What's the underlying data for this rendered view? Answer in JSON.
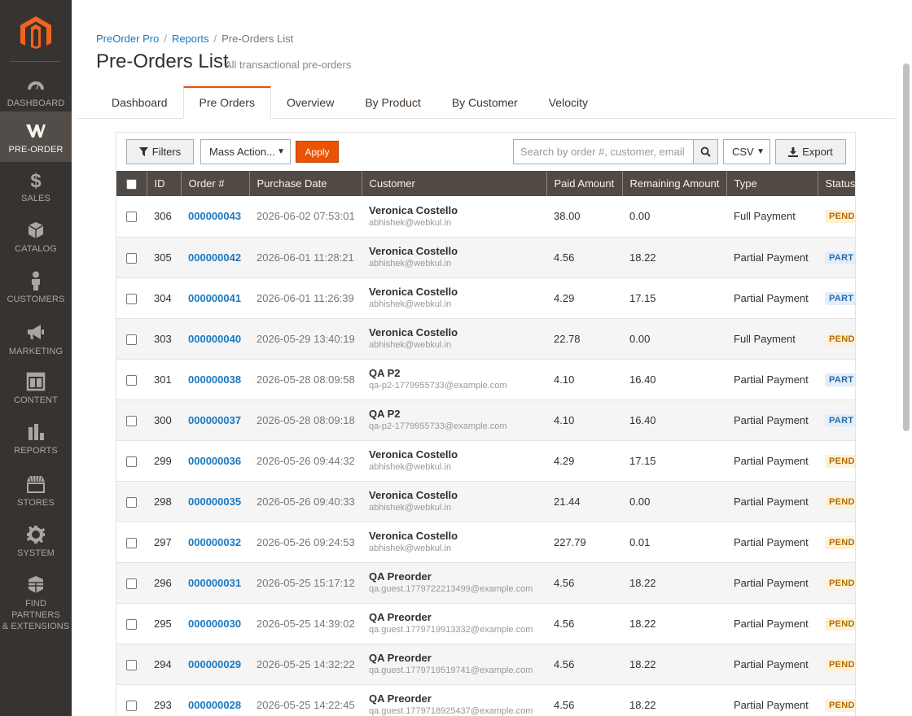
{
  "sidebar": {
    "items": [
      {
        "label": "Dashboard",
        "icon": "dashboard-icon",
        "active": false
      },
      {
        "label": "Pre-Order",
        "icon": "preorder-icon",
        "active": true
      },
      {
        "label": "Sales",
        "icon": "dollar-icon",
        "active": false
      },
      {
        "label": "Catalog",
        "icon": "box-icon",
        "active": false
      },
      {
        "label": "Customers",
        "icon": "person-icon",
        "active": false
      },
      {
        "label": "Marketing",
        "icon": "megaphone-icon",
        "active": false
      },
      {
        "label": "Content",
        "icon": "layout-icon",
        "active": false
      },
      {
        "label": "Reports",
        "icon": "bar-chart-icon",
        "active": false
      },
      {
        "label": "Stores",
        "icon": "store-icon",
        "active": false
      },
      {
        "label": "System",
        "icon": "gear-icon",
        "active": false
      },
      {
        "label1": "Find Partners",
        "label2": "& Extensions",
        "icon": "extensions-icon",
        "active": false
      }
    ]
  },
  "breadcrumb": {
    "item1": "PreOrder Pro",
    "item2": "Reports",
    "current": "Pre-Orders List"
  },
  "header": {
    "title": "Pre-Orders List",
    "subtitle": "All transactional pre-orders"
  },
  "tabs": [
    {
      "label": "Dashboard",
      "active": false
    },
    {
      "label": "Pre Orders",
      "active": true
    },
    {
      "label": "Overview",
      "active": false
    },
    {
      "label": "By Product",
      "active": false
    },
    {
      "label": "By Customer",
      "active": false
    },
    {
      "label": "Velocity",
      "active": false
    }
  ],
  "toolbar": {
    "filters_label": "Filters",
    "mass_action_label": "Mass Action...",
    "apply_label": "Apply",
    "search_placeholder": "Search by order #, customer, email",
    "export_format": "CSV",
    "export_label": "Export"
  },
  "table": {
    "columns": [
      "ID",
      "Order #",
      "Purchase Date",
      "Customer",
      "Paid Amount",
      "Remaining Amount",
      "Type",
      "Status"
    ],
    "rows": [
      {
        "id": "306",
        "order": "000000043",
        "date": "2026-06-02 07:53:01",
        "name": "Veronica Costello",
        "email": "abhishek@webkul.in",
        "paid": "38.00",
        "remaining": "0.00",
        "type": "Full Payment",
        "status": "PEND"
      },
      {
        "id": "305",
        "order": "000000042",
        "date": "2026-06-01 11:28:21",
        "name": "Veronica Costello",
        "email": "abhishek@webkul.in",
        "paid": "4.56",
        "remaining": "18.22",
        "type": "Partial Payment",
        "status": "PART"
      },
      {
        "id": "304",
        "order": "000000041",
        "date": "2026-06-01 11:26:39",
        "name": "Veronica Costello",
        "email": "abhishek@webkul.in",
        "paid": "4.29",
        "remaining": "17.15",
        "type": "Partial Payment",
        "status": "PART"
      },
      {
        "id": "303",
        "order": "000000040",
        "date": "2026-05-29 13:40:19",
        "name": "Veronica Costello",
        "email": "abhishek@webkul.in",
        "paid": "22.78",
        "remaining": "0.00",
        "type": "Full Payment",
        "status": "PEND"
      },
      {
        "id": "301",
        "order": "000000038",
        "date": "2026-05-28 08:09:58",
        "name": "QA P2",
        "email": "qa-p2-1779955733@example.com",
        "paid": "4.10",
        "remaining": "16.40",
        "type": "Partial Payment",
        "status": "PART"
      },
      {
        "id": "300",
        "order": "000000037",
        "date": "2026-05-28 08:09:18",
        "name": "QA P2",
        "email": "qa-p2-1779955733@example.com",
        "paid": "4.10",
        "remaining": "16.40",
        "type": "Partial Payment",
        "status": "PART"
      },
      {
        "id": "299",
        "order": "000000036",
        "date": "2026-05-26 09:44:32",
        "name": "Veronica Costello",
        "email": "abhishek@webkul.in",
        "paid": "4.29",
        "remaining": "17.15",
        "type": "Partial Payment",
        "status": "PEND"
      },
      {
        "id": "298",
        "order": "000000035",
        "date": "2026-05-26 09:40:33",
        "name": "Veronica Costello",
        "email": "abhishek@webkul.in",
        "paid": "21.44",
        "remaining": "0.00",
        "type": "Partial Payment",
        "status": "PEND"
      },
      {
        "id": "297",
        "order": "000000032",
        "date": "2026-05-26 09:24:53",
        "name": "Veronica Costello",
        "email": "abhishek@webkul.in",
        "paid": "227.79",
        "remaining": "0.01",
        "type": "Partial Payment",
        "status": "PEND"
      },
      {
        "id": "296",
        "order": "000000031",
        "date": "2026-05-25 15:17:12",
        "name": "QA Preorder",
        "email": "qa.guest.1779722213499@example.com",
        "paid": "4.56",
        "remaining": "18.22",
        "type": "Partial Payment",
        "status": "PEND"
      },
      {
        "id": "295",
        "order": "000000030",
        "date": "2026-05-25 14:39:02",
        "name": "QA Preorder",
        "email": "qa.guest.1779719913332@example.com",
        "paid": "4.56",
        "remaining": "18.22",
        "type": "Partial Payment",
        "status": "PEND"
      },
      {
        "id": "294",
        "order": "000000029",
        "date": "2026-05-25 14:32:22",
        "name": "QA Preorder",
        "email": "qa.guest.1779719519741@example.com",
        "paid": "4.56",
        "remaining": "18.22",
        "type": "Partial Payment",
        "status": "PEND"
      },
      {
        "id": "293",
        "order": "000000028",
        "date": "2026-05-25 14:22:45",
        "name": "QA Preorder",
        "email": "qa.guest.1779718925437@example.com",
        "paid": "4.56",
        "remaining": "18.22",
        "type": "Partial Payment",
        "status": "PEND"
      }
    ]
  },
  "colors": {
    "sidebar_bg": "#373330",
    "sidebar_active": "#524d49",
    "accent": "#eb5202",
    "link": "#1979c3",
    "table_header": "#514943"
  }
}
